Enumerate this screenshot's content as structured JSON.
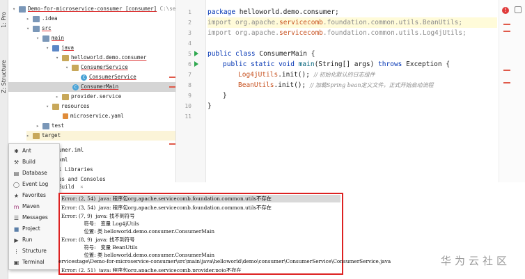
{
  "left_strip": {
    "project_label": "1: Pro",
    "structure_label": "Z: Structure"
  },
  "tree": {
    "rows": [
      {
        "label": "Demo-for-microservice-consumer [consumer]",
        "suffix": "C:\\se"
      },
      {
        "label": ".idea"
      },
      {
        "label": "src"
      },
      {
        "label": "main"
      },
      {
        "label": "java"
      },
      {
        "label": "helloworld.demo.consumer"
      },
      {
        "label": "ConsumerService"
      },
      {
        "label": "ConsumerService"
      },
      {
        "label": "ConsumerMain"
      },
      {
        "label": "provider.service"
      },
      {
        "label": "resources"
      },
      {
        "label": "microservice.yaml"
      },
      {
        "label": "test"
      },
      {
        "label": "target"
      }
    ],
    "peek": [
      "umer.iml",
      "xml",
      "l Libraries",
      "es and Consoles"
    ]
  },
  "editor": {
    "line_numbers": [
      "1",
      "2",
      "3",
      "4",
      "5",
      "6",
      "7",
      "8",
      "9",
      "10",
      "11"
    ],
    "lines": {
      "l1_kw": "package",
      "l1_rest": " helloworld.demo.consumer;",
      "l2_kw": "import",
      "l2_a": " org.apache.",
      "l2_b": "servicecomb",
      "l2_c": ".foundation.common.utils.BeanUtils;",
      "l3_kw": "import",
      "l3_a": " org.apache.",
      "l3_b": "servicecomb",
      "l3_c": ".foundation.common.utils.Log4jUtils;",
      "l5_kw": "public class",
      "l5_rest": " ConsumerMain {",
      "l6_kw": "public static void",
      "l6_name": " main",
      "l6_args": "(String[] args) ",
      "l6_kw2": "throws",
      "l6_rest": " Exception {",
      "l7_cls": "Log4jUtils",
      "l7_call": ".init(); ",
      "l7_cmt": "// 初始化默认的日志组件",
      "l8_cls": "BeanUtils",
      "l8_call": ".init(); ",
      "l8_cmt": "// 加载Spring bean定义文件，正式开始启动流程",
      "l9": "}",
      "l10": "}"
    }
  },
  "popup": {
    "items": [
      {
        "icon": "ant-icon",
        "label": "Ant"
      },
      {
        "icon": "build-icon",
        "label": "Build"
      },
      {
        "icon": "database-icon",
        "label": "Database"
      },
      {
        "icon": "event-log-icon",
        "label": "Event Log"
      },
      {
        "icon": "favorites-icon",
        "label": "Favorites"
      },
      {
        "icon": "maven-icon",
        "label": "Maven"
      },
      {
        "icon": "messages-icon",
        "label": "Messages"
      },
      {
        "icon": "project-icon",
        "label": "Project"
      },
      {
        "icon": "run-icon",
        "label": "Run"
      },
      {
        "icon": "structure-icon",
        "label": "Structure"
      },
      {
        "icon": "terminal-icon",
        "label": "Terminal"
      }
    ]
  },
  "build": {
    "tab": "Build",
    "errors": [
      "Error: (2, 54)  java: 程序包org.apache.servicecomb.foundation.common.utils不存在",
      "Error: (3, 54)  java: 程序包org.apache.servicecomb.foundation.common.utils不存在",
      "Error: (7, 9)  java: 找不到符号",
      "              符号:   变量 Log4jUtils",
      "              位置: 类 helloworld.demo.consumer.ConsumerMain",
      "Error: (8, 9)  java: 找不到符号",
      "              符号:   变量 BeanUtils",
      "              位置: 类 helloworld.demo.consumer.ConsumerMain"
    ],
    "path_line": "ervicestage\\Demo-for-microservice-consumer\\src\\main\\java\\helloworld\\demo\\consumer\\ConsumerService\\ConsumerService.java",
    "last_error": "Error: (2, 51)  java: 程序包org.apache.servicecomb.provider.pojo不存在"
  },
  "watermark": "华为云社区",
  "colors": {
    "error_border": "#dd2222",
    "keyword": "#0033b3",
    "orange_ident": "#c7511f",
    "run_green": "#2fa84f"
  }
}
